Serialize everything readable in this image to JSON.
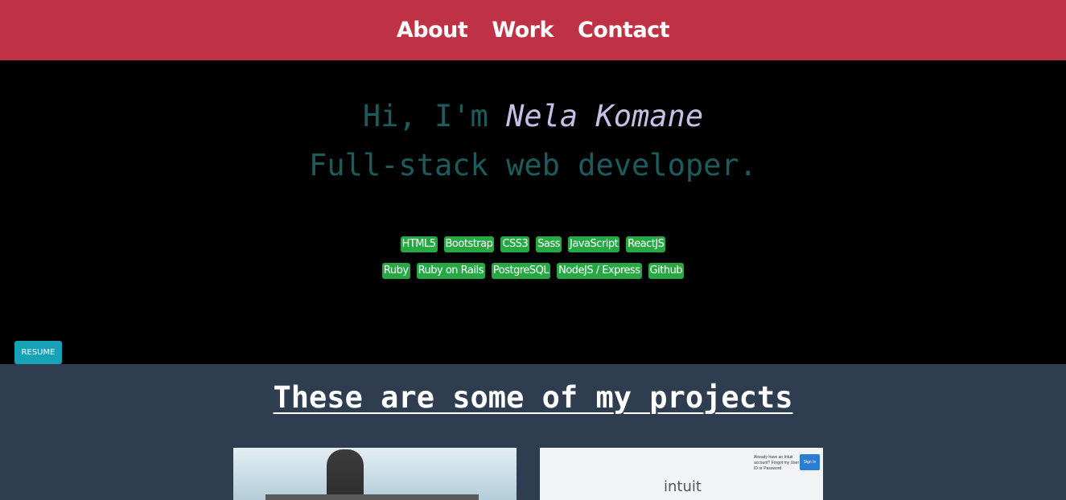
{
  "nav": {
    "about": "About",
    "work": "Work",
    "contact": "Contact"
  },
  "hero": {
    "greeting_prefix": "Hi, I'm",
    "name": "Nela Komane",
    "role": "Full-stack web developer.",
    "skills_row1": [
      "HTML5",
      "Bootstrap",
      "CSS3",
      "Sass",
      "JavaScript",
      "ReactJS"
    ],
    "skills_row2": [
      "Ruby",
      "Ruby on Rails",
      "PostgreSQL",
      "NodeJS / Express",
      "Github"
    ],
    "resume_label": "RESUME"
  },
  "projects": {
    "title": "These are some of my projects",
    "cards": [
      {
        "preview": "project-1-screenshot"
      },
      {
        "preview": "project-2-screenshot",
        "signin_text": "Already have an Intuit account? Forgot my User ID or Password",
        "signin_button": "Sign In",
        "brand": "intuit"
      }
    ]
  },
  "colors": {
    "navbar": "#bf3145",
    "greeting": "#1d5c5c",
    "name": "#c7c0e6",
    "badge": "#28a745",
    "resume": "#17a2b8",
    "projects_bg": "#2e3d4f"
  }
}
